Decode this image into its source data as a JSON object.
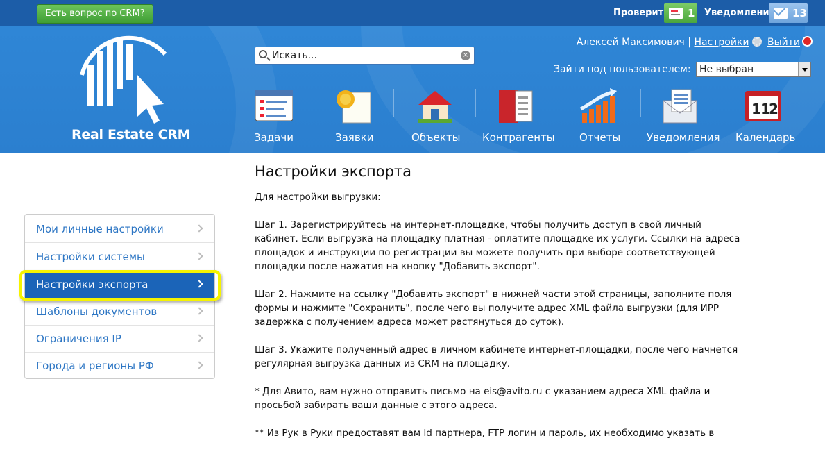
{
  "topbar": {
    "question_button": "Есть вопрос по CRM?",
    "check_label": "Проверить",
    "check_count": "1",
    "notifications_label": "Уведомления",
    "notifications_count": "13"
  },
  "brand": {
    "name": "Real Estate CRM"
  },
  "search": {
    "placeholder": "Искать..."
  },
  "user": {
    "name": "Алексей Максимович",
    "separator": "|",
    "settings_link": "Настройки",
    "logout_link": "Выйти"
  },
  "impersonate": {
    "label": "Зайти под пользователем:",
    "selected": "Не выбран"
  },
  "nav": [
    {
      "label": "Задачи",
      "icon": "tasks-icon"
    },
    {
      "label": "Заявки",
      "icon": "requests-icon"
    },
    {
      "label": "Объекты",
      "icon": "objects-icon"
    },
    {
      "label": "Контрагенты",
      "icon": "contacts-book-icon"
    },
    {
      "label": "Отчеты",
      "icon": "reports-chart-icon"
    },
    {
      "label": "Уведомления",
      "icon": "notifications-envelope-icon"
    },
    {
      "label": "Календарь",
      "icon": "calendar-icon"
    }
  ],
  "sidebar": {
    "items": [
      {
        "label": "Мои личные настройки",
        "active": false
      },
      {
        "label": "Настройки системы",
        "active": false
      },
      {
        "label": "Настройки экспорта",
        "active": true
      },
      {
        "label": "Шаблоны документов",
        "active": false
      },
      {
        "label": "Ограничения IP",
        "active": false
      },
      {
        "label": "Города и регионы РФ",
        "active": false
      }
    ]
  },
  "main": {
    "title": "Настройки экспорта",
    "intro": "Для настройки выгрузки:",
    "step1": "Шаг 1. Зарегистрируйтесь на интернет-площадке, чтобы получить доступ в свой личный кабинет. Если выгрузка на площадку платная - оплатите площадке их услуги. Ссылки на адреса площадок и инструкции по регистрации вы можете получить при выборе соответствующей площадки после нажатия на кнопку \"Добавить экспорт\".",
    "step2": "Шаг 2. Нажмите на ссылку \"Добавить экспорт\" в нижней части этой страницы, заполните поля формы и нажмите \"Сохранить\", после чего вы получите адрес XML файла выгрузки (для ИРР задержка с получением адреса может растянуться до суток).",
    "step3": "Шаг 3. Укажите полученный адрес в личном кабинете интернет-площадки, после чего начнется регулярная выгрузка данных из CRM на площадку.",
    "note1": "* Для Авито, вам нужно отправить письмо на eis@avito.ru с указанием адреса XML файла и просьбой забирать ваши данные с этого адреса.",
    "note2": "** Из Рук в Руки предоставят вам Id партнера, FTP логин и пароль, их необходимо указать в"
  },
  "colors": {
    "header": "#2b7fcf",
    "topbar": "#1c5da8",
    "active_menu": "#1b64b8",
    "link": "#2d76c4",
    "highlight": "#f5f300"
  }
}
